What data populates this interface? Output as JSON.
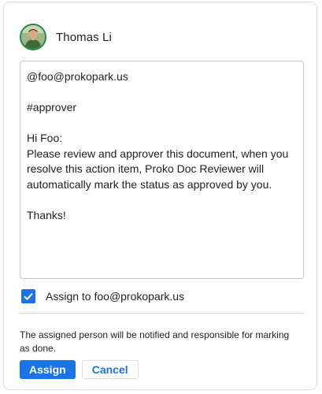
{
  "comment": {
    "author": "Thomas Li",
    "avatar_icon": "user-avatar-photo",
    "body": "@foo@prokopark.us\n\n#approver\n\nHi Foo:\nPlease review and approver this document, when you resolve this action item, Proko Doc Reviewer will automatically mark the status as approved by you.\n\nThanks!"
  },
  "assign": {
    "checked": true,
    "label": "Assign to foo@prokopark.us",
    "note": "The assigned person will be notified and responsible for marking as done."
  },
  "actions": {
    "assign_label": "Assign",
    "cancel_label": "Cancel"
  },
  "colors": {
    "accent": "#1a73e8",
    "avatar_ring": "#1e8e3e",
    "border": "#dadce0"
  }
}
